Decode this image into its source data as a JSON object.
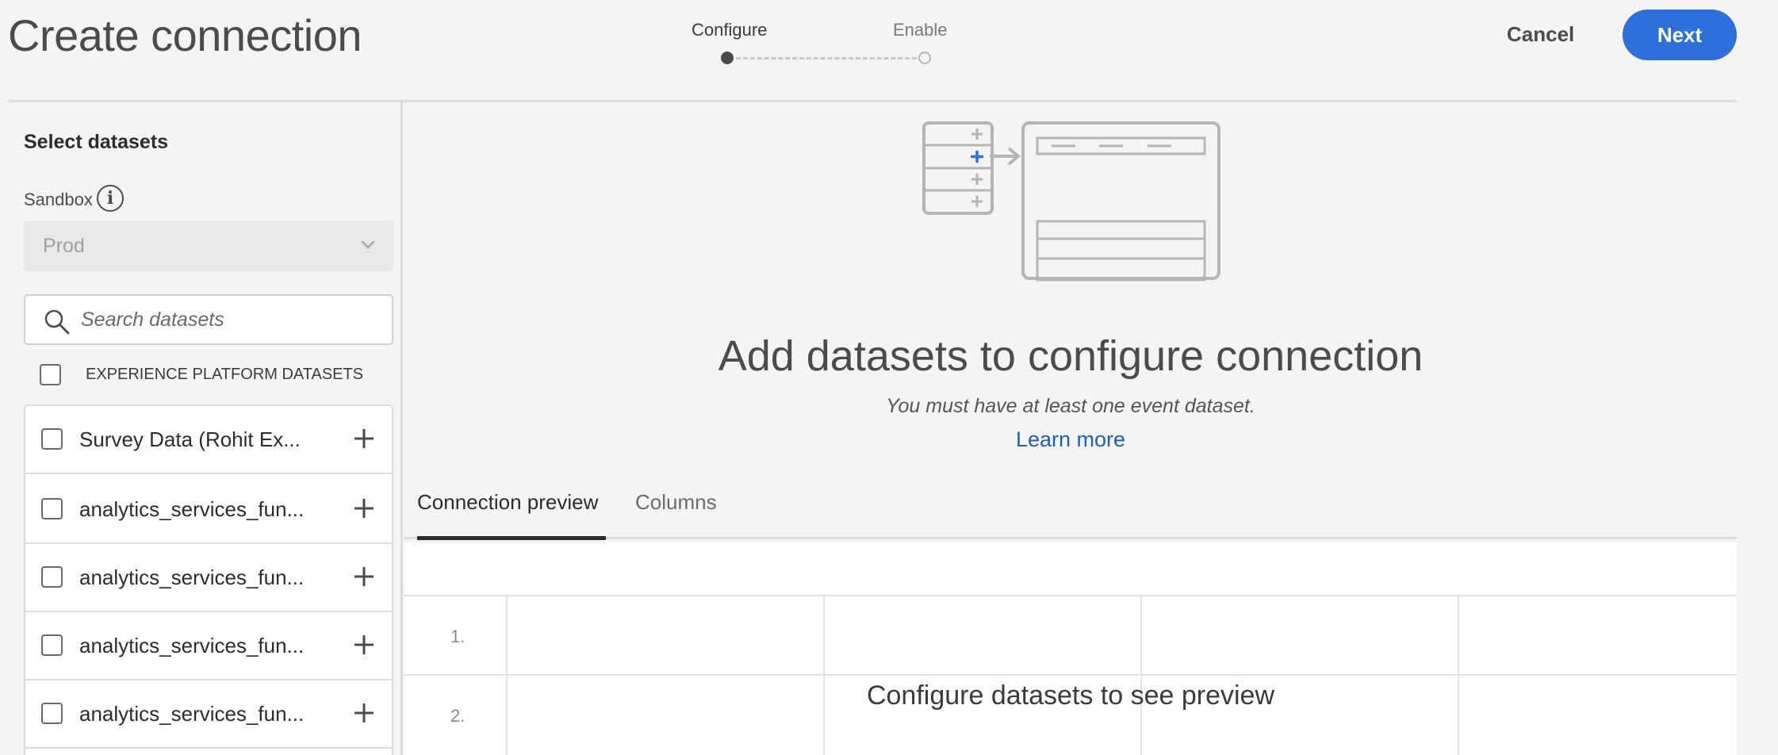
{
  "header": {
    "title": "Create connection",
    "cancel_label": "Cancel",
    "next_label": "Next",
    "steps": [
      {
        "label": "Configure",
        "state": "active"
      },
      {
        "label": "Enable",
        "state": "inactive"
      }
    ]
  },
  "left_panel": {
    "title": "Select datasets",
    "sandbox_label": "Sandbox",
    "info_icon": "info-icon",
    "sandbox_value": "Prod",
    "search_placeholder": "Search datasets",
    "select_all_label": "EXPERIENCE PLATFORM DATASETS",
    "datasets": [
      {
        "name": "Survey Data (Rohit Ex..."
      },
      {
        "name": "analytics_services_fun..."
      },
      {
        "name": "analytics_services_fun..."
      },
      {
        "name": "analytics_services_fun..."
      },
      {
        "name": "analytics_services_fun..."
      }
    ]
  },
  "main": {
    "heading": "Add datasets to configure connection",
    "subtext": "You must have at least one event dataset.",
    "learn_more": "Learn more",
    "tabs": [
      {
        "label": "Connection preview",
        "active": true
      },
      {
        "label": "Columns",
        "active": false
      }
    ],
    "preview_rows": [
      "1.",
      "2."
    ],
    "preview_message": "Configure datasets to see preview"
  },
  "colors": {
    "accent": "#2d6fdb",
    "link": "#1d5ec6",
    "background": "#f4f4f4"
  }
}
